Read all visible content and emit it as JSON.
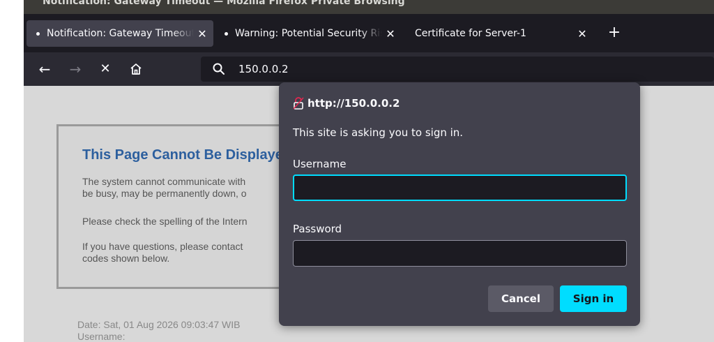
{
  "window": {
    "title": "Notification: Gateway Timeout — Mozilla Firefox Private Browsing"
  },
  "tabs": [
    {
      "label": "Notification: Gateway Timeout",
      "active": true
    },
    {
      "label": "Warning: Potential Security Risk Ahead",
      "active": false
    },
    {
      "label": "Certificate for Server-1",
      "active": false
    }
  ],
  "toolbar": {
    "url": "150.0.0.2"
  },
  "page": {
    "title": "This Page Cannot Be Displayed",
    "para1_line1": "The system cannot communicate with",
    "para1_line2": "be busy, may be permanently down, o",
    "para2": "Please check the spelling of the Intern",
    "para3_line1": "If you have questions, please contact",
    "para3_line2": "codes shown below.",
    "date": "Date: Sat, 01 Aug 2026 09:03:47 WIB",
    "username": "Username:"
  },
  "dialog": {
    "origin": "http://150.0.0.2",
    "message": "This site is asking you to sign in.",
    "username_label": "Username",
    "username_value": "",
    "password_label": "Password",
    "password_value": "",
    "cancel_label": "Cancel",
    "signin_label": "Sign in"
  },
  "icons": {
    "back": "←",
    "forward": "→",
    "stop": "✕",
    "close_tab": "✕",
    "new_tab": "+"
  },
  "colors": {
    "accent": "#00ddff",
    "link_title": "#2c5f9e",
    "lock_insecure": "#e22850"
  }
}
